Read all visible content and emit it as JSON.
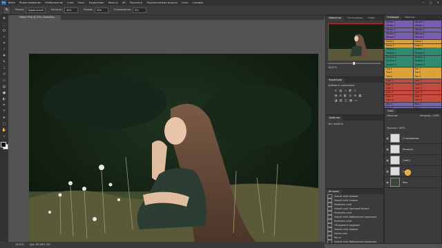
{
  "menubar": {
    "logo": "Ps",
    "items": [
      "Файл",
      "Редактирование",
      "Изображение",
      "Слои",
      "Текст",
      "Выделение",
      "Фильтр",
      "3D",
      "Просмотр",
      "Подключаемые модули",
      "Окно",
      "Справка"
    ],
    "window_controls": [
      "—",
      "▢",
      "✕"
    ]
  },
  "options_bar": {
    "tool_icon": "brush-icon",
    "fields": [
      {
        "label": "Режим:",
        "value": "Нормальный"
      },
      {
        "label": "Непрозр.:",
        "value": "44%"
      },
      {
        "label": "Нажим:",
        "value": "30%"
      },
      {
        "label": "Сглаживание:",
        "value": "0%"
      }
    ]
  },
  "document_tab": {
    "title": "FINAL*.PSD @ 25% (Selective..."
  },
  "tools": [
    "move-icon",
    "marquee-icon",
    "lasso-icon",
    "quick-select-icon",
    "crop-icon",
    "eyedropper-icon",
    "healing-icon",
    "brush-icon",
    "stamp-icon",
    "history-brush-icon",
    "eraser-icon",
    "gradient-icon",
    "blur-icon",
    "dodge-icon",
    "pen-icon",
    "text-icon",
    "path-select-icon",
    "shape-icon",
    "hand-icon",
    "zoom-icon"
  ],
  "status_bar": {
    "zoom": "16,67%",
    "doc": "Док: 69,4M/1,39Г"
  },
  "navigator": {
    "tabs": [
      "Навигатор",
      "Гистограмма",
      "Инфо"
    ],
    "zoom": "16,67%"
  },
  "actions_panel": {
    "tabs": [
      "Операции",
      "Образцы"
    ],
    "colors": [
      "#7a5fb0",
      "#7a5fb0",
      "#7a5fb0",
      "#7a5fb0",
      "#7a5fb0",
      "#d9a33a",
      "#d9a33a",
      "#2f8a72",
      "#2f8a72",
      "#2f8a72",
      "#2f8a72",
      "#2f8a72",
      "#d9a33a",
      "#d9a33a",
      "#d9a33a",
      "#c54b40",
      "#c54b40",
      "#c54b40",
      "#c54b40",
      "#c54b40",
      "#c54b40",
      "#6f64b8",
      "#6f64b8",
      "#6f64b8",
      "#4c7bc1",
      "#4c7bc1"
    ],
    "rows": [
      [
        "Объем 1",
        "Объем 1"
      ],
      [
        "Объем 2",
        "Объем 2"
      ],
      [
        "Объем 3",
        "Объем 3"
      ],
      [
        "Объем 4",
        "Объем 4"
      ],
      [
        "Объем 5",
        "Объем 5"
      ],
      [
        "Кожа 1",
        "Кожа 1"
      ],
      [
        "Кожа 2",
        "Кожа 2"
      ],
      [
        "Зелень 1",
        "Зелень 1"
      ],
      [
        "Зелень 2",
        "Зелень 2"
      ],
      [
        "Зелень 3",
        "Зелень 3"
      ],
      [
        "Зелень 4",
        "Зелень 4"
      ],
      [
        "Зелень 5",
        "Зелень 5"
      ],
      [
        "Тон 1",
        "Тон 1"
      ],
      [
        "Тон 2",
        "Тон 2"
      ],
      [
        "Тон 3",
        "Тон 3"
      ],
      [
        "Свет 1",
        "Свет 1"
      ],
      [
        "Свет 2",
        "Свет 2"
      ],
      [
        "Свет 3",
        "Свет 3"
      ],
      [
        "Свет 4",
        "Свет 4"
      ],
      [
        "Свет 5",
        "Свет 5"
      ],
      [
        "Свет 6",
        "Свет 6"
      ],
      [
        "Фон 1",
        "Фон 1"
      ],
      [
        "Фон 2",
        "Фон 2"
      ],
      [
        "Фон 3",
        "Фон 3"
      ],
      [
        "Резкость",
        "Резкость"
      ],
      [
        "Финал",
        "Финал"
      ]
    ]
  },
  "adjustments_panel": {
    "tabs": [
      "Коррекция"
    ],
    "title": "Добавить коррекцию"
  },
  "properties_panel": {
    "tabs": [
      "Свойства"
    ],
    "text": "Нет свойств"
  },
  "layers_panel": {
    "tabs": [
      "Слои"
    ],
    "blend_label": "Обычные",
    "opacity_label": "Непрозр.: 100%",
    "fill_label": "Заливка: 100%",
    "layers": [
      {
        "name": "Сглаживание"
      },
      {
        "name": "Резкость"
      },
      {
        "name": "Слой 1"
      },
      {
        "name": "Слой 2"
      },
      {
        "name": "Фон"
      }
    ]
  },
  "history_panel": {
    "tabs": [
      "История"
    ],
    "items": [
      "Новый слой: Кривые",
      "Новый слой: Уровни",
      "Изменить слой",
      "Новый слой: Цветовой баланс",
      "Изменить слой",
      "Новый слой: Выборочная коррекция",
      "Изменить слой",
      "Объединить видимые",
      "Новый слой: Кривые",
      "Маска слоя",
      "Кисть",
      "Новый слой: Выборочная коррекция",
      "Изменить слой"
    ]
  }
}
